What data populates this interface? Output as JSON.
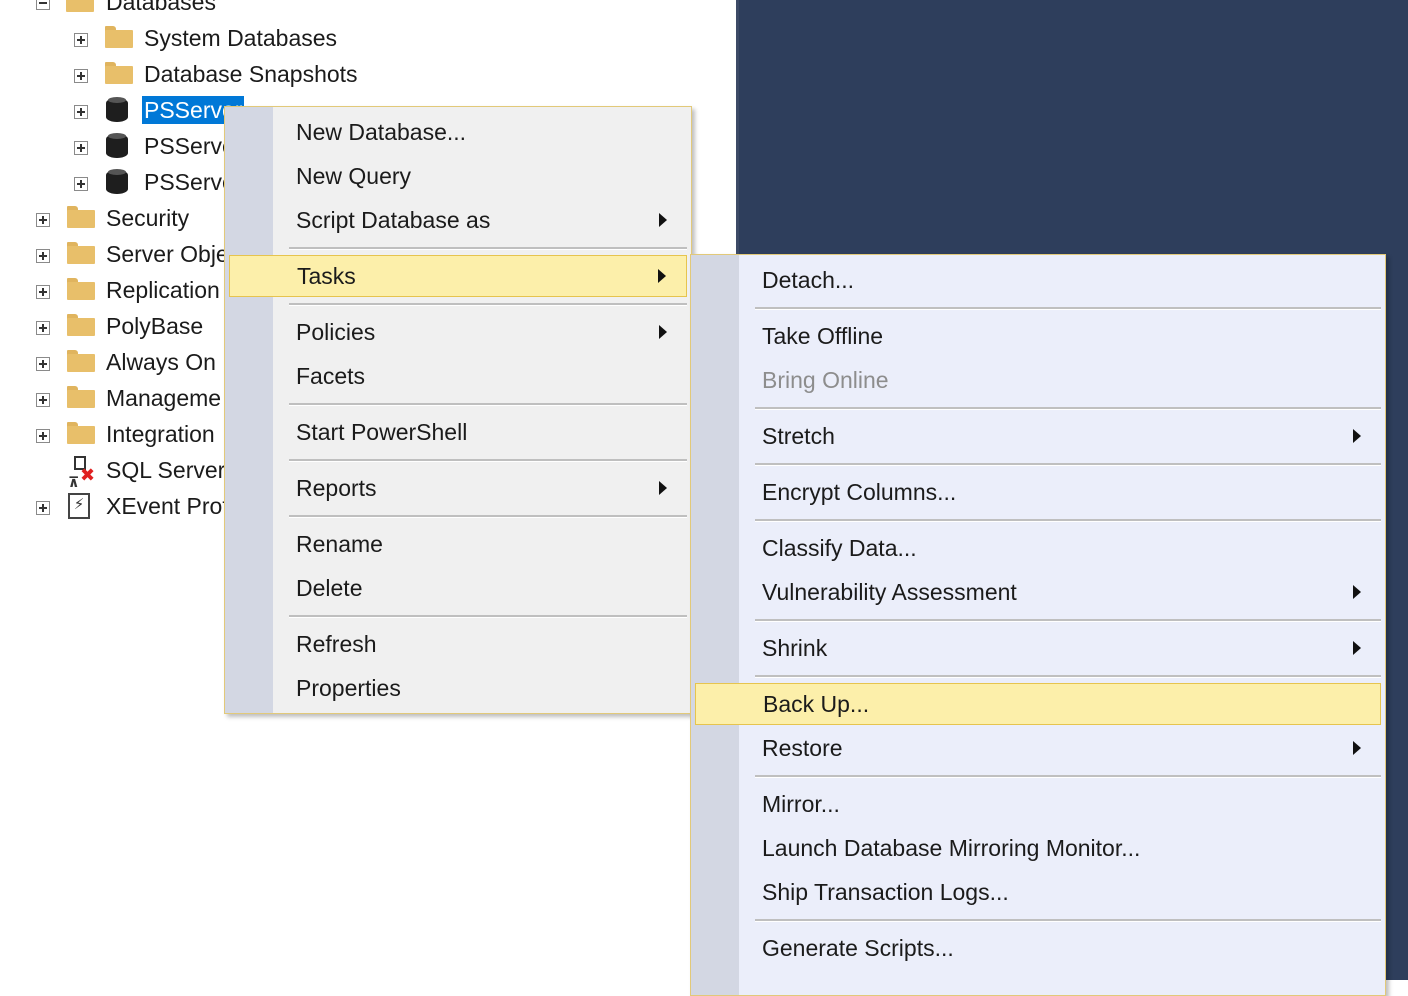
{
  "tree": {
    "databases_label": "Databases",
    "system_databases": "System Databases",
    "database_snapshots": "Database Snapshots",
    "db1": "PSServer",
    "db2": "PSServe",
    "db3": "PSServe",
    "security": "Security",
    "server_objects": "Server Obje",
    "replication": "Replication",
    "polybase": "PolyBase",
    "always_on": "Always On",
    "management": "Manageme",
    "integration": "Integration",
    "sql_agent": "SQL Server",
    "xevent": "XEvent Prof"
  },
  "context_menu": {
    "new_database": "New Database...",
    "new_query": "New Query",
    "script_database_as": "Script Database as",
    "tasks": "Tasks",
    "policies": "Policies",
    "facets": "Facets",
    "start_powershell": "Start PowerShell",
    "reports": "Reports",
    "rename": "Rename",
    "delete": "Delete",
    "refresh": "Refresh",
    "properties": "Properties"
  },
  "tasks_menu": {
    "detach": "Detach...",
    "take_offline": "Take Offline",
    "bring_online": "Bring Online",
    "stretch": "Stretch",
    "encrypt_columns": "Encrypt Columns...",
    "classify_data": "Classify Data...",
    "vulnerability_assessment": "Vulnerability Assessment",
    "shrink": "Shrink",
    "back_up": "Back Up...",
    "restore": "Restore",
    "mirror": "Mirror...",
    "launch_mirroring_monitor": "Launch Database Mirroring Monitor...",
    "ship_transaction_logs": "Ship Transaction Logs...",
    "generate_scripts": "Generate Scripts..."
  },
  "colors": {
    "dark_panel": "#2e3e5c",
    "selection": "#0078d7",
    "menu_highlight": "#fcefaa",
    "menu_highlight_border": "#e6c44e"
  }
}
